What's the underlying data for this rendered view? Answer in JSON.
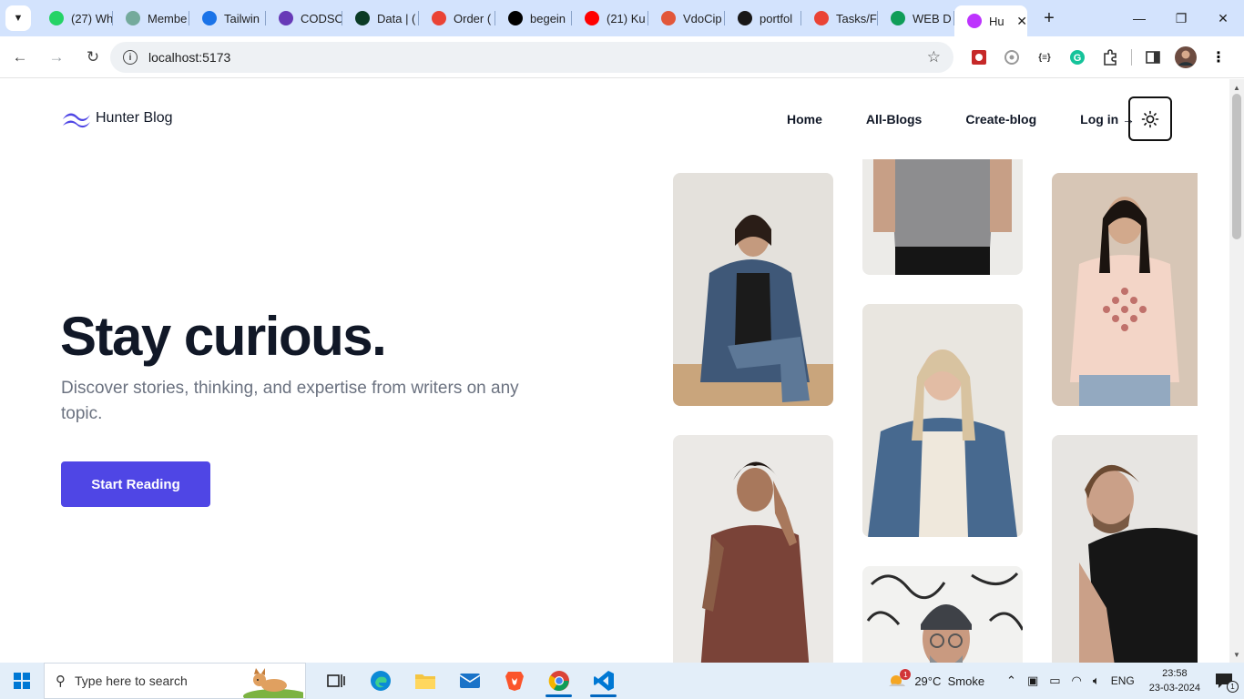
{
  "browser": {
    "tabs": [
      {
        "title": "(27) Wh",
        "icon": "whatsapp-icon",
        "color": "#25d366"
      },
      {
        "title": "Membe",
        "icon": "chatgpt-icon",
        "color": "#74aa9c"
      },
      {
        "title": "Tailwin",
        "icon": "tailwind-play-icon",
        "color": "#1a73e8"
      },
      {
        "title": "CODSO",
        "icon": "forms-icon",
        "color": "#673ab7"
      },
      {
        "title": "Data | (",
        "icon": "mongodb-icon",
        "color": "#0b3b25"
      },
      {
        "title": "Order (",
        "icon": "gmail-icon",
        "color": "#ea4335"
      },
      {
        "title": "begein",
        "icon": "vercel-icon",
        "color": "#000000"
      },
      {
        "title": "(21) Ku",
        "icon": "youtube-icon",
        "color": "#ff0000"
      },
      {
        "title": "VdoCip",
        "icon": "vdocipher-icon",
        "color": "#e2573a"
      },
      {
        "title": "portfol",
        "icon": "github-icon",
        "color": "#181717"
      },
      {
        "title": "Tasks/F",
        "icon": "gmail-icon",
        "color": "#ea4335"
      },
      {
        "title": "WEB D",
        "icon": "drive-icon",
        "color": "#0f9d58"
      },
      {
        "title": "Hu",
        "icon": "vite-icon",
        "color": "#bd34fe"
      }
    ],
    "url": "localhost:5173",
    "new_tab_symbol": "+"
  },
  "site": {
    "brand": "Hunter Blog",
    "nav": {
      "home": "Home",
      "blogs": "All-Blogs",
      "create": "Create-blog",
      "login": "Log in →"
    },
    "hero": {
      "title": "Stay curious.",
      "subtitle": "Discover stories, thinking, and expertise from writers on any topic.",
      "cta": "Start Reading"
    },
    "accent_color": "#4f46e5"
  },
  "taskbar": {
    "search_placeholder": "Type here to search",
    "weather": "29°C  Smoke",
    "language": "ENG",
    "time": "23:58",
    "date": "23-03-2024",
    "notification_count": "1",
    "weather_badge": "1"
  }
}
